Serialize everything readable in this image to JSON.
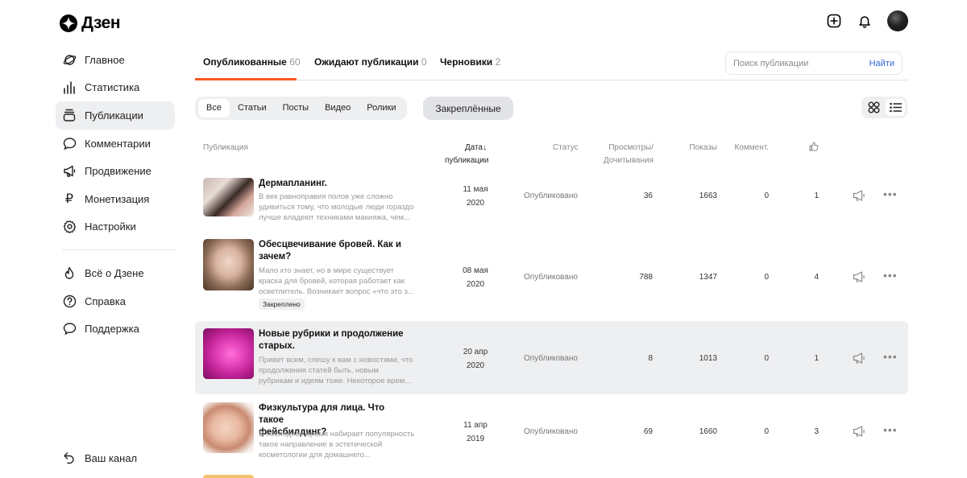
{
  "brand": {
    "name": "Дзен"
  },
  "sidebar": {
    "items": [
      {
        "label": "Главное",
        "icon": "planet-icon"
      },
      {
        "label": "Статистика",
        "icon": "bar-chart-icon"
      },
      {
        "label": "Публикации",
        "icon": "publications-icon",
        "active": true
      },
      {
        "label": "Комментарии",
        "icon": "comment-icon"
      },
      {
        "label": "Продвижение",
        "icon": "megaphone-icon"
      },
      {
        "label": "Монетизация",
        "icon": "ruble-icon"
      },
      {
        "label": "Настройки",
        "icon": "gear-icon"
      }
    ],
    "secondary": [
      {
        "label": "Всё о Дзене",
        "icon": "flame-icon"
      },
      {
        "label": "Справка",
        "icon": "help-icon"
      },
      {
        "label": "Поддержка",
        "icon": "support-icon"
      }
    ],
    "channel_label": "Ваш канал"
  },
  "tabs": [
    {
      "label": "Опубликованные",
      "count": "60",
      "active": true
    },
    {
      "label": "Ожидают публикации",
      "count": "0"
    },
    {
      "label": "Черновики",
      "count": "2"
    }
  ],
  "search": {
    "placeholder": "Поиск публикации",
    "button": "Найти"
  },
  "filters": [
    "Все",
    "Статьи",
    "Посты",
    "Видео",
    "Ролики"
  ],
  "pinned_label": "Закреплённые",
  "table": {
    "headers": {
      "publication": "Публикация",
      "date_line1": "Дата↓",
      "date_line2": "публикации",
      "status": "Статус",
      "views_line1": "Просмотры/",
      "views_line2": "Дочитывания",
      "impressions": "Показы",
      "comments": "Коммент."
    },
    "rows": [
      {
        "title": "Дермапланинг.",
        "desc1": "В век равноправия полов уже сложно",
        "desc2": "удивиться тому, что молодые люди гораздо",
        "desc3": "лучше владеют техниками макияжа, чем...",
        "date1": "11 мая",
        "date2": "2020",
        "status": "Опубликовано",
        "views": "36",
        "impressions": "1663",
        "comments": "0",
        "likes": "1"
      },
      {
        "title1": "Обесцвечивание бровей. Как и",
        "title2": "зачем?",
        "desc1": "Мало кто знает, но в мире существует",
        "desc2": "краска для бровей, которая работает как",
        "desc3": "осветлитель. Возникает вопрос «что это з...",
        "badge": "Закреплено",
        "date1": "08 мая",
        "date2": "2020",
        "status": "Опубликовано",
        "views": "788",
        "impressions": "1347",
        "comments": "0",
        "likes": "4"
      },
      {
        "title1": "Новые рубрики и продолжение",
        "title2": "старых.",
        "desc1": "Привет всем, спешу к вам с новостями, что",
        "desc2": "продолжения статей быть, новым",
        "desc3": "рубрикам и идеям тоже. Некоторое врем...",
        "date1": "20 апр",
        "date2": "2020",
        "status": "Опубликовано",
        "views": "8",
        "impressions": "1013",
        "comments": "0",
        "likes": "1"
      },
      {
        "title1": "Физкультура для лица. Что такое",
        "title2": "фейсбилдинг?",
        "desc1": "В последнее время набирает популярность",
        "desc2": "такое направление в эстетической",
        "desc3": "косметологии для домашнего...",
        "date1": "11 апр",
        "date2": "2019",
        "status": "Опубликовано",
        "views": "69",
        "impressions": "1660",
        "comments": "0",
        "likes": "3"
      }
    ]
  },
  "colors": {
    "accent": "#ff5722",
    "link": "#3367d6",
    "highlight": "#eeeff1"
  }
}
